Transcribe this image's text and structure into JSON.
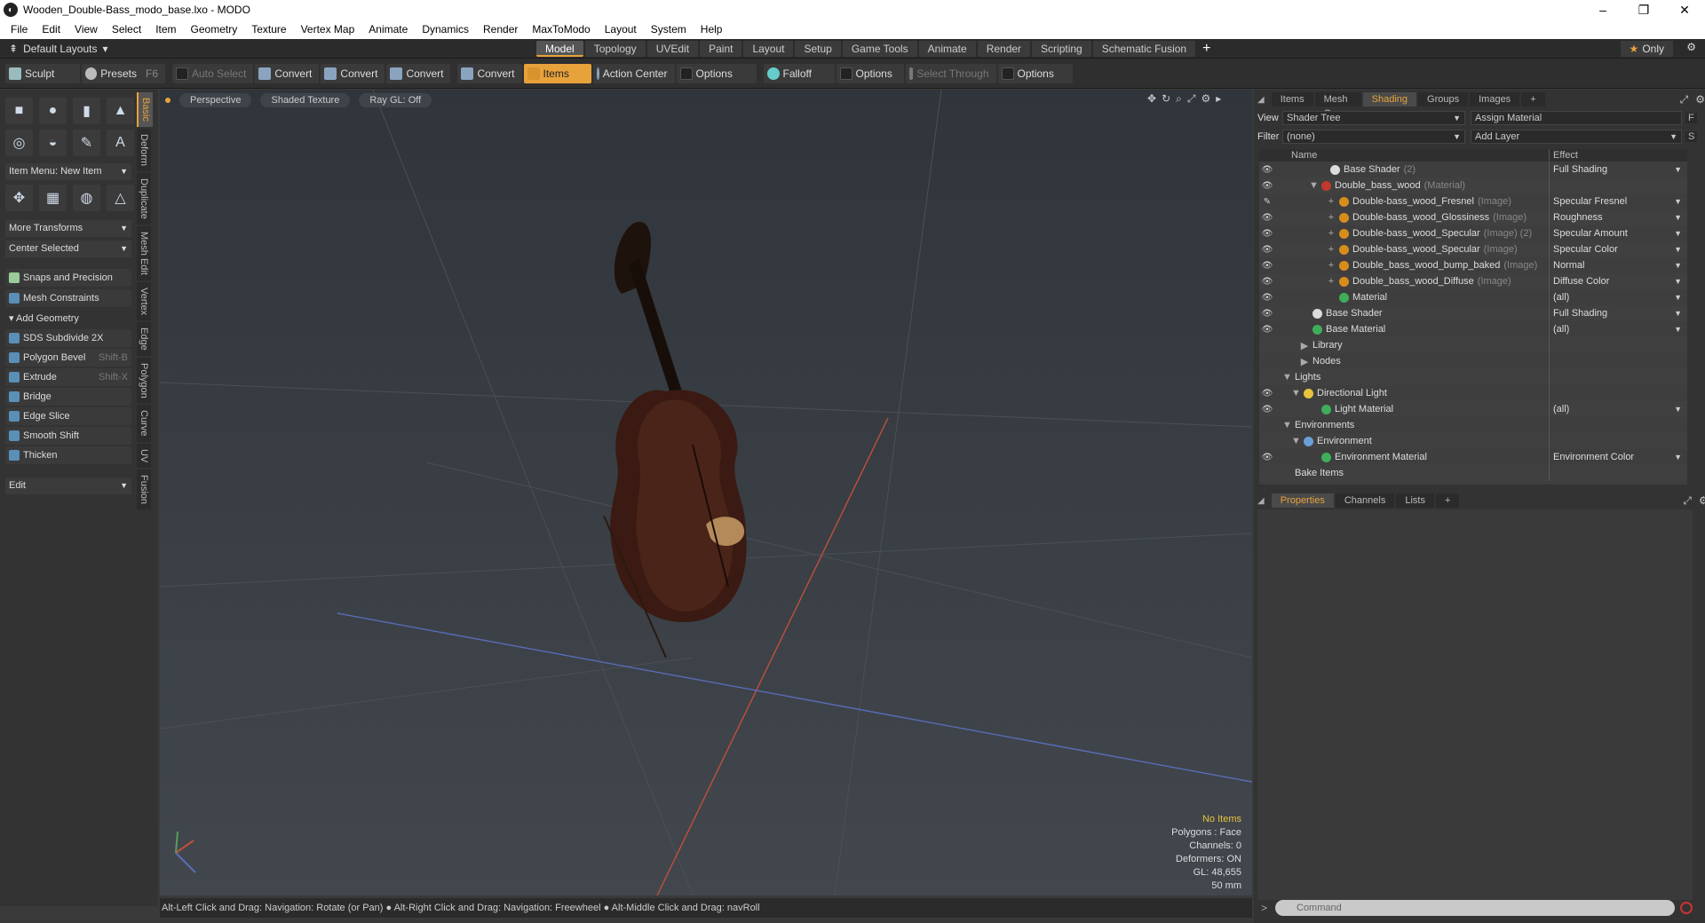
{
  "window": {
    "title": "Wooden_Double-Bass_modo_base.lxo - MODO",
    "controls": [
      "–",
      "❐",
      "✕"
    ]
  },
  "menu": [
    "File",
    "Edit",
    "View",
    "Select",
    "Item",
    "Geometry",
    "Texture",
    "Vertex Map",
    "Animate",
    "Dynamics",
    "Render",
    "MaxToModo",
    "Layout",
    "System",
    "Help"
  ],
  "layoutbar": {
    "layout_label": "Default Layouts",
    "tabs": [
      "Model",
      "Topology",
      "UVEdit",
      "Paint",
      "Layout",
      "Setup",
      "Game Tools",
      "Animate",
      "Render",
      "Scripting",
      "Schematic Fusion"
    ],
    "active_tab": "Model",
    "plus": "+",
    "only_label": "Only"
  },
  "toolbar": {
    "sculpt": "Sculpt",
    "presets": "Presets",
    "presets_key": "F6",
    "auto_select": "Auto Select",
    "convert1": "Convert",
    "convert2": "Convert",
    "convert3": "Convert",
    "convert4": "Convert",
    "items": "Items",
    "action_center": "Action Center",
    "options1": "Options",
    "falloff": "Falloff",
    "options2": "Options",
    "select_through": "Select Through",
    "options3": "Options"
  },
  "leftpanel": {
    "vtabs": [
      "Basic",
      "Deform",
      "Duplicate",
      "Mesh Edit",
      "Vertex",
      "Edge",
      "Polygon",
      "Curve",
      "UV",
      "Fusion"
    ],
    "item_menu": "Item Menu: New Item",
    "more_transforms": "More Transforms",
    "center_selected": "Center Selected",
    "snaps": "Snaps and Precision",
    "mesh_constraints": "Mesh Constraints",
    "add_geometry": "Add Geometry",
    "tools": [
      {
        "label": "SDS Subdivide 2X",
        "key": ""
      },
      {
        "label": "Polygon Bevel",
        "key": "Shift-B"
      },
      {
        "label": "Extrude",
        "key": "Shift-X"
      },
      {
        "label": "Bridge",
        "key": ""
      },
      {
        "label": "Edge Slice",
        "key": ""
      },
      {
        "label": "Smooth Shift",
        "key": ""
      },
      {
        "label": "Thicken",
        "key": ""
      }
    ],
    "edit": "Edit"
  },
  "viewport": {
    "view_mode": "Perspective",
    "shading": "Shaded Texture",
    "raygl": "Ray GL: Off",
    "stats": {
      "no_items": "No Items",
      "polygons": "Polygons : Face",
      "channels": "Channels: 0",
      "deformers": "Deformers: ON",
      "gl": "GL: 48,655",
      "focal": "50 mm"
    }
  },
  "status": "Alt-Left Click and Drag: Navigation: Rotate (or Pan) ● Alt-Right Click and Drag: Navigation: Freewheel ● Alt-Middle Click and Drag: navRoll",
  "rightpanel": {
    "tabs": [
      "Items",
      "Mesh Ops",
      "Shading",
      "Groups",
      "Images"
    ],
    "active_tab": "Shading",
    "view_label": "View",
    "view_value": "Shader Tree",
    "assign_material": "Assign Material",
    "filter_label": "Filter",
    "filter_value": "(none)",
    "add_layer": "Add Layer",
    "col_name": "Name",
    "col_effect": "Effect",
    "rows": [
      {
        "indent": 4,
        "eye": "👁",
        "twirl": "",
        "color": "#dcdcdc",
        "name": "Base Shader",
        "sub": "(2)",
        "effect": "Full Shading",
        "dd": true
      },
      {
        "indent": 3,
        "eye": "👁",
        "twirl": "▼",
        "color": "#c03a2b",
        "name": "Double_bass_wood",
        "sub": "(Material)",
        "effect": "",
        "dd": false
      },
      {
        "indent": 5,
        "eye": "✎",
        "twirl": "+",
        "color": "#d98c1c",
        "name": "Double-bass_wood_Fresnel",
        "sub": "(Image)",
        "effect": "Specular Fresnel",
        "dd": true
      },
      {
        "indent": 5,
        "eye": "👁",
        "twirl": "+",
        "color": "#d98c1c",
        "name": "Double-bass_wood_Glossiness",
        "sub": "(Image)",
        "effect": "Roughness",
        "dd": true
      },
      {
        "indent": 5,
        "eye": "👁",
        "twirl": "+",
        "color": "#d98c1c",
        "name": "Double-bass_wood_Specular",
        "sub": "(Image) (2)",
        "effect": "Specular Amount",
        "dd": true
      },
      {
        "indent": 5,
        "eye": "👁",
        "twirl": "+",
        "color": "#d98c1c",
        "name": "Double-bass_wood_Specular",
        "sub": "(Image)",
        "effect": "Specular Color",
        "dd": true
      },
      {
        "indent": 5,
        "eye": "👁",
        "twirl": "+",
        "color": "#d98c1c",
        "name": "Double_bass_wood_bump_baked",
        "sub": "(Image)",
        "effect": "Normal",
        "dd": true
      },
      {
        "indent": 5,
        "eye": "👁",
        "twirl": "+",
        "color": "#d98c1c",
        "name": "Double_bass_wood_Diffuse",
        "sub": "(Image)",
        "effect": "Diffuse Color",
        "dd": true
      },
      {
        "indent": 5,
        "eye": "👁",
        "twirl": "",
        "color": "#3fae5a",
        "name": "Material",
        "sub": "",
        "effect": "(all)",
        "dd": true
      },
      {
        "indent": 2,
        "eye": "👁",
        "twirl": "",
        "color": "#dcdcdc",
        "name": "Base Shader",
        "sub": "",
        "effect": "Full Shading",
        "dd": true
      },
      {
        "indent": 2,
        "eye": "👁",
        "twirl": "",
        "color": "#3fae5a",
        "name": "Base Material",
        "sub": "",
        "effect": "(all)",
        "dd": true
      },
      {
        "indent": 2,
        "eye": "",
        "twirl": "▶",
        "color": "",
        "name": "Library",
        "sub": "",
        "effect": "",
        "dd": false
      },
      {
        "indent": 2,
        "eye": "",
        "twirl": "▶",
        "color": "",
        "name": "Nodes",
        "sub": "",
        "effect": "",
        "dd": false
      },
      {
        "indent": 0,
        "eye": "",
        "twirl": "▼",
        "color": "",
        "name": "Lights",
        "sub": "",
        "effect": "",
        "dd": false
      },
      {
        "indent": 1,
        "eye": "👁",
        "twirl": "▼",
        "color": "#e8c23c",
        "name": "Directional Light",
        "sub": "",
        "effect": "",
        "dd": false
      },
      {
        "indent": 3,
        "eye": "👁",
        "twirl": "",
        "color": "#3fae5a",
        "name": "Light Material",
        "sub": "",
        "effect": "(all)",
        "dd": true
      },
      {
        "indent": 0,
        "eye": "",
        "twirl": "▼",
        "color": "",
        "name": "Environments",
        "sub": "",
        "effect": "",
        "dd": false
      },
      {
        "indent": 1,
        "eye": "",
        "twirl": "▼",
        "color": "#6aa0d8",
        "name": "Environment",
        "sub": "",
        "effect": "",
        "dd": false
      },
      {
        "indent": 3,
        "eye": "👁",
        "twirl": "",
        "color": "#3fae5a",
        "name": "Environment Material",
        "sub": "",
        "effect": "Environment Color",
        "dd": true
      },
      {
        "indent": 0,
        "eye": "",
        "twirl": "",
        "color": "",
        "name": "Bake Items",
        "sub": "",
        "effect": "",
        "dd": false
      }
    ],
    "props_tabs": [
      "Properties",
      "Channels",
      "Lists"
    ],
    "props_active": "Properties",
    "command_placeholder": "Command"
  }
}
